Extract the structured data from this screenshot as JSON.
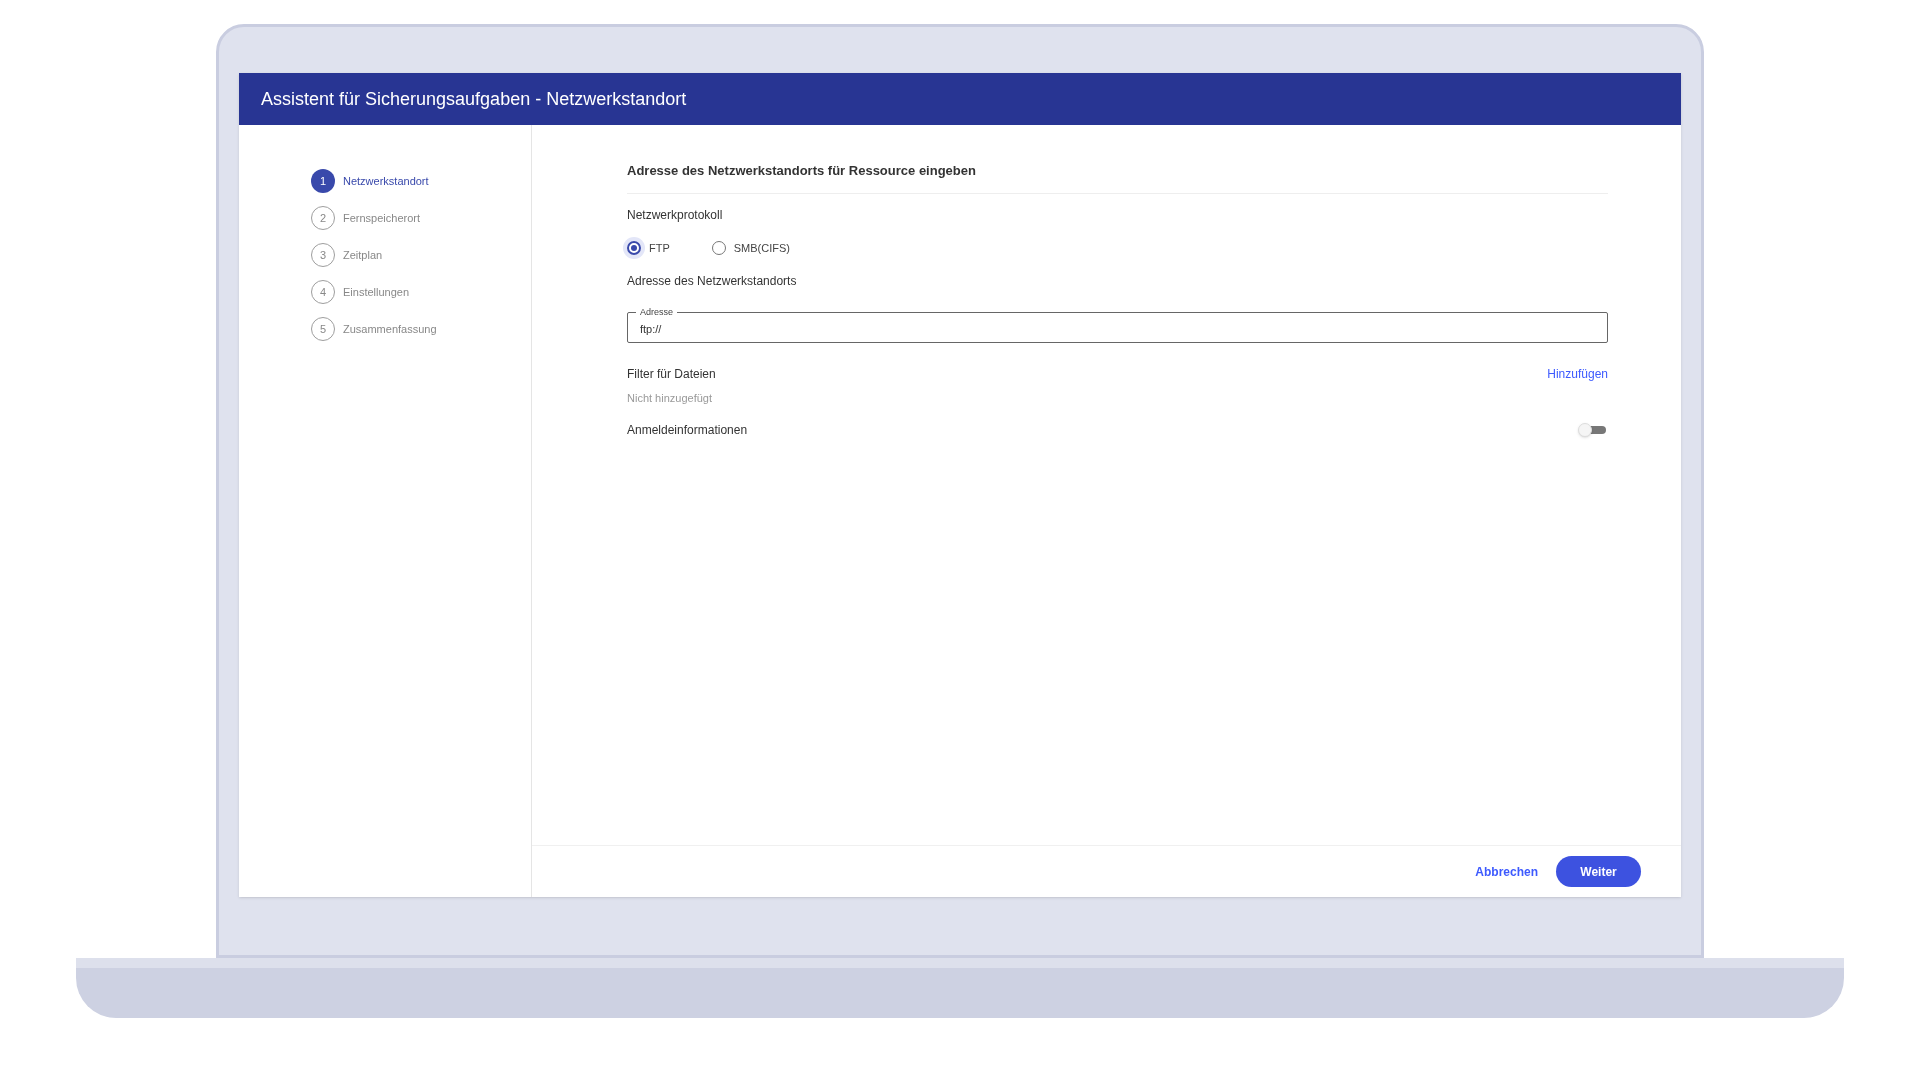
{
  "window": {
    "title": "Assistent für Sicherungsaufgaben - Netzwerkstandort"
  },
  "steps": [
    {
      "number": "1",
      "label": "Netzwerkstandort",
      "selected": true
    },
    {
      "number": "2",
      "label": "Fernspeicherort",
      "selected": false
    },
    {
      "number": "3",
      "label": "Zeitplan",
      "selected": false
    },
    {
      "number": "4",
      "label": "Einstellungen",
      "selected": false
    },
    {
      "number": "5",
      "label": "Zusammenfassung",
      "selected": false
    }
  ],
  "section_title": "Adresse des Netzwerkstandorts für Ressource eingeben",
  "protocol": {
    "label": "Netzwerkprotokoll",
    "options": [
      {
        "label": "FTP",
        "selected": true
      },
      {
        "label": "SMB(CIFS)",
        "selected": false
      }
    ]
  },
  "address": {
    "label": "Adresse des Netzwerkstandorts",
    "field_label": "Adresse",
    "value": "ftp://"
  },
  "filter": {
    "label": "Filter für Dateien",
    "action": "Hinzufügen",
    "status": "Nicht hinzugefügt"
  },
  "credentials": {
    "label": "Anmeldeinformationen",
    "on": false
  },
  "buttons": {
    "cancel": "Abbrechen",
    "next": "Weiter"
  }
}
